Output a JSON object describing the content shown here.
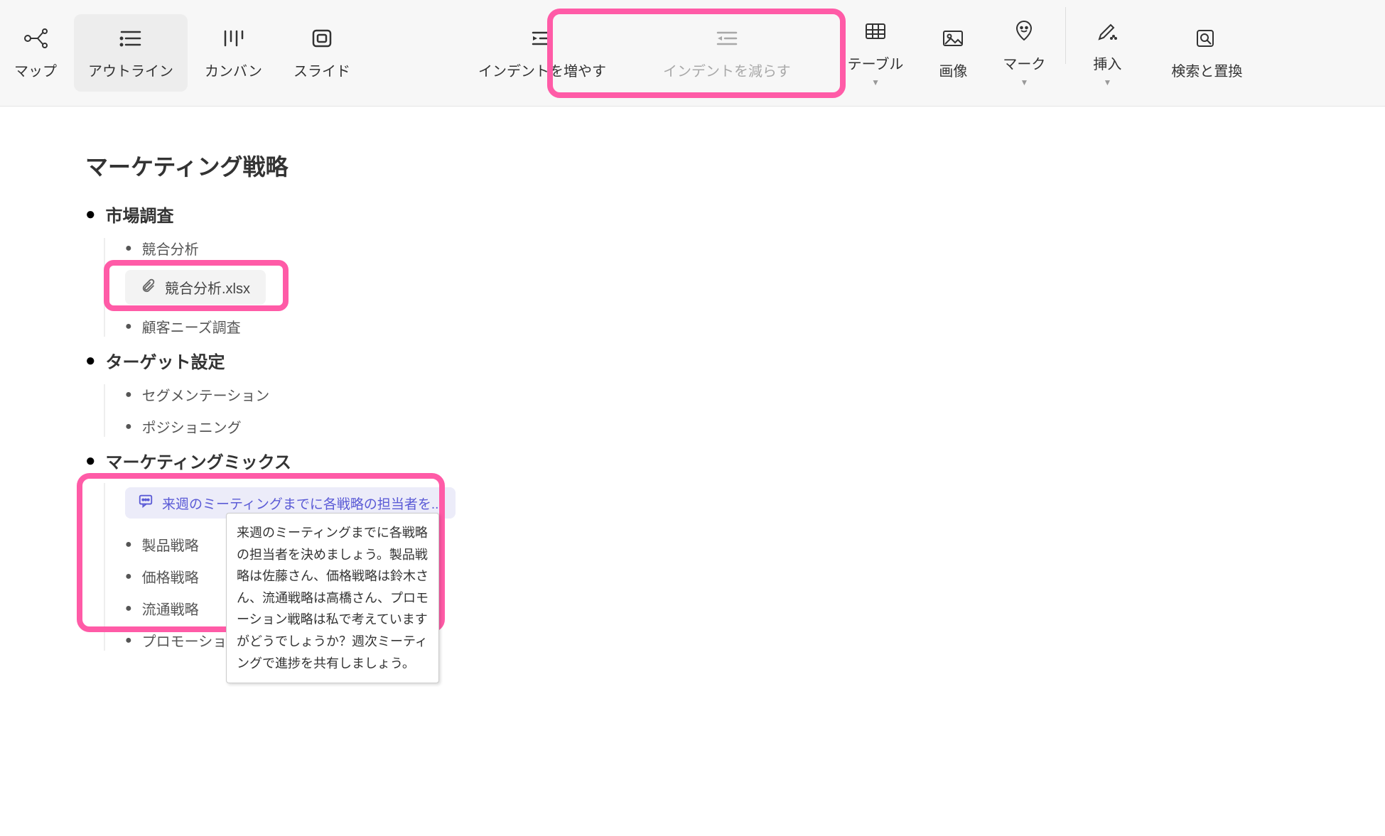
{
  "toolbar": {
    "views": {
      "mindmap": "マップ",
      "outline": "アウトライン",
      "kanban": "カンバン",
      "slide": "スライド"
    },
    "indent": {
      "increase": "インデントを増やす",
      "decrease": "インデントを減らす"
    },
    "insert": {
      "table": "テーブル",
      "image": "画像",
      "mark": "マーク",
      "insert": "挿入"
    },
    "search": "検索と置換"
  },
  "doc": {
    "title": "マーケティング戦略",
    "sections": {
      "market_research": {
        "title": "市場調査",
        "items": {
          "competitor": "競合分析",
          "attachment": "競合分析.xlsx",
          "customer_needs": "顧客ニーズ調査"
        }
      },
      "targeting": {
        "title": "ターゲット設定",
        "items": {
          "segmentation": "セグメンテーション",
          "positioning": "ポジショニング"
        }
      },
      "marketing_mix": {
        "title": "マーケティングミックス",
        "comment_summary": "来週のミーティングまでに各戦略の担当者を...",
        "comment_full": "来週のミーティングまでに各戦略の担当者を決めましょう。製品戦略は佐藤さん、価格戦略は鈴木さん、流通戦略は高橋さん、プロモーション戦略は私で考えていますがどうでしょうか？週次ミーティングで進捗を共有しましょう。",
        "items": {
          "product": "製品戦略",
          "price": "価格戦略",
          "place": "流通戦略",
          "promotion": "プロモーション戦略"
        }
      }
    }
  },
  "colors": {
    "highlight": "#ff5ba7",
    "comment": "#5b5bd6"
  }
}
